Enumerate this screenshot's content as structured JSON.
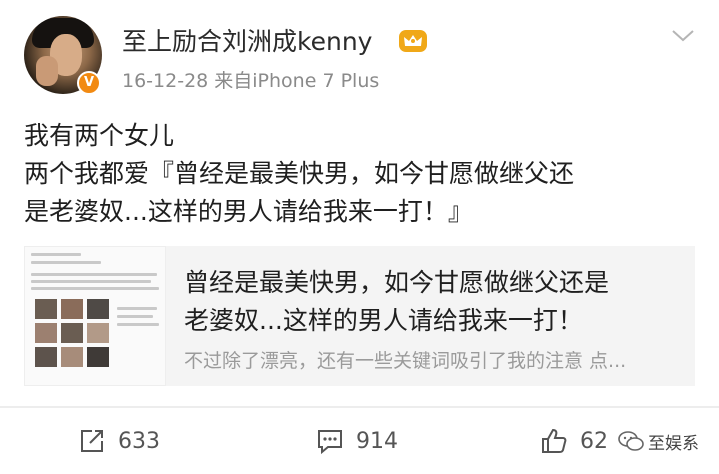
{
  "post": {
    "username": "至上励合刘洲成kenny",
    "verified_badge": "V",
    "meta": "16-12-28  来自iPhone 7 Plus",
    "text_lines": [
      "我有两个女儿",
      "两个我都爱『曾经是最美快男，如今甘愿做继父还",
      "是老婆奴...这样的男人请给我来一打！』"
    ]
  },
  "card": {
    "title_lines": [
      "曾经是最美快男，如今甘愿做继父还是",
      "老婆奴...这样的男人请给我来一打！"
    ],
    "description": "不过除了漂亮，还有一些关键词吸引了我的注意 点..."
  },
  "actions": {
    "repost_count": "633",
    "comment_count": "914",
    "like_count": "62"
  },
  "watermark": {
    "label": "至娱系"
  },
  "icons": {
    "crown": "crown-icon",
    "more": "chevron-down-icon",
    "repost": "repost-icon",
    "comment": "comment-icon",
    "like": "thumbs-up-icon",
    "wechat": "wechat-icon"
  },
  "colors": {
    "badge": "#f28a12",
    "crown": "#f0a818",
    "meta_text": "#8a8a8a",
    "card_bg": "#f4f4f4"
  }
}
